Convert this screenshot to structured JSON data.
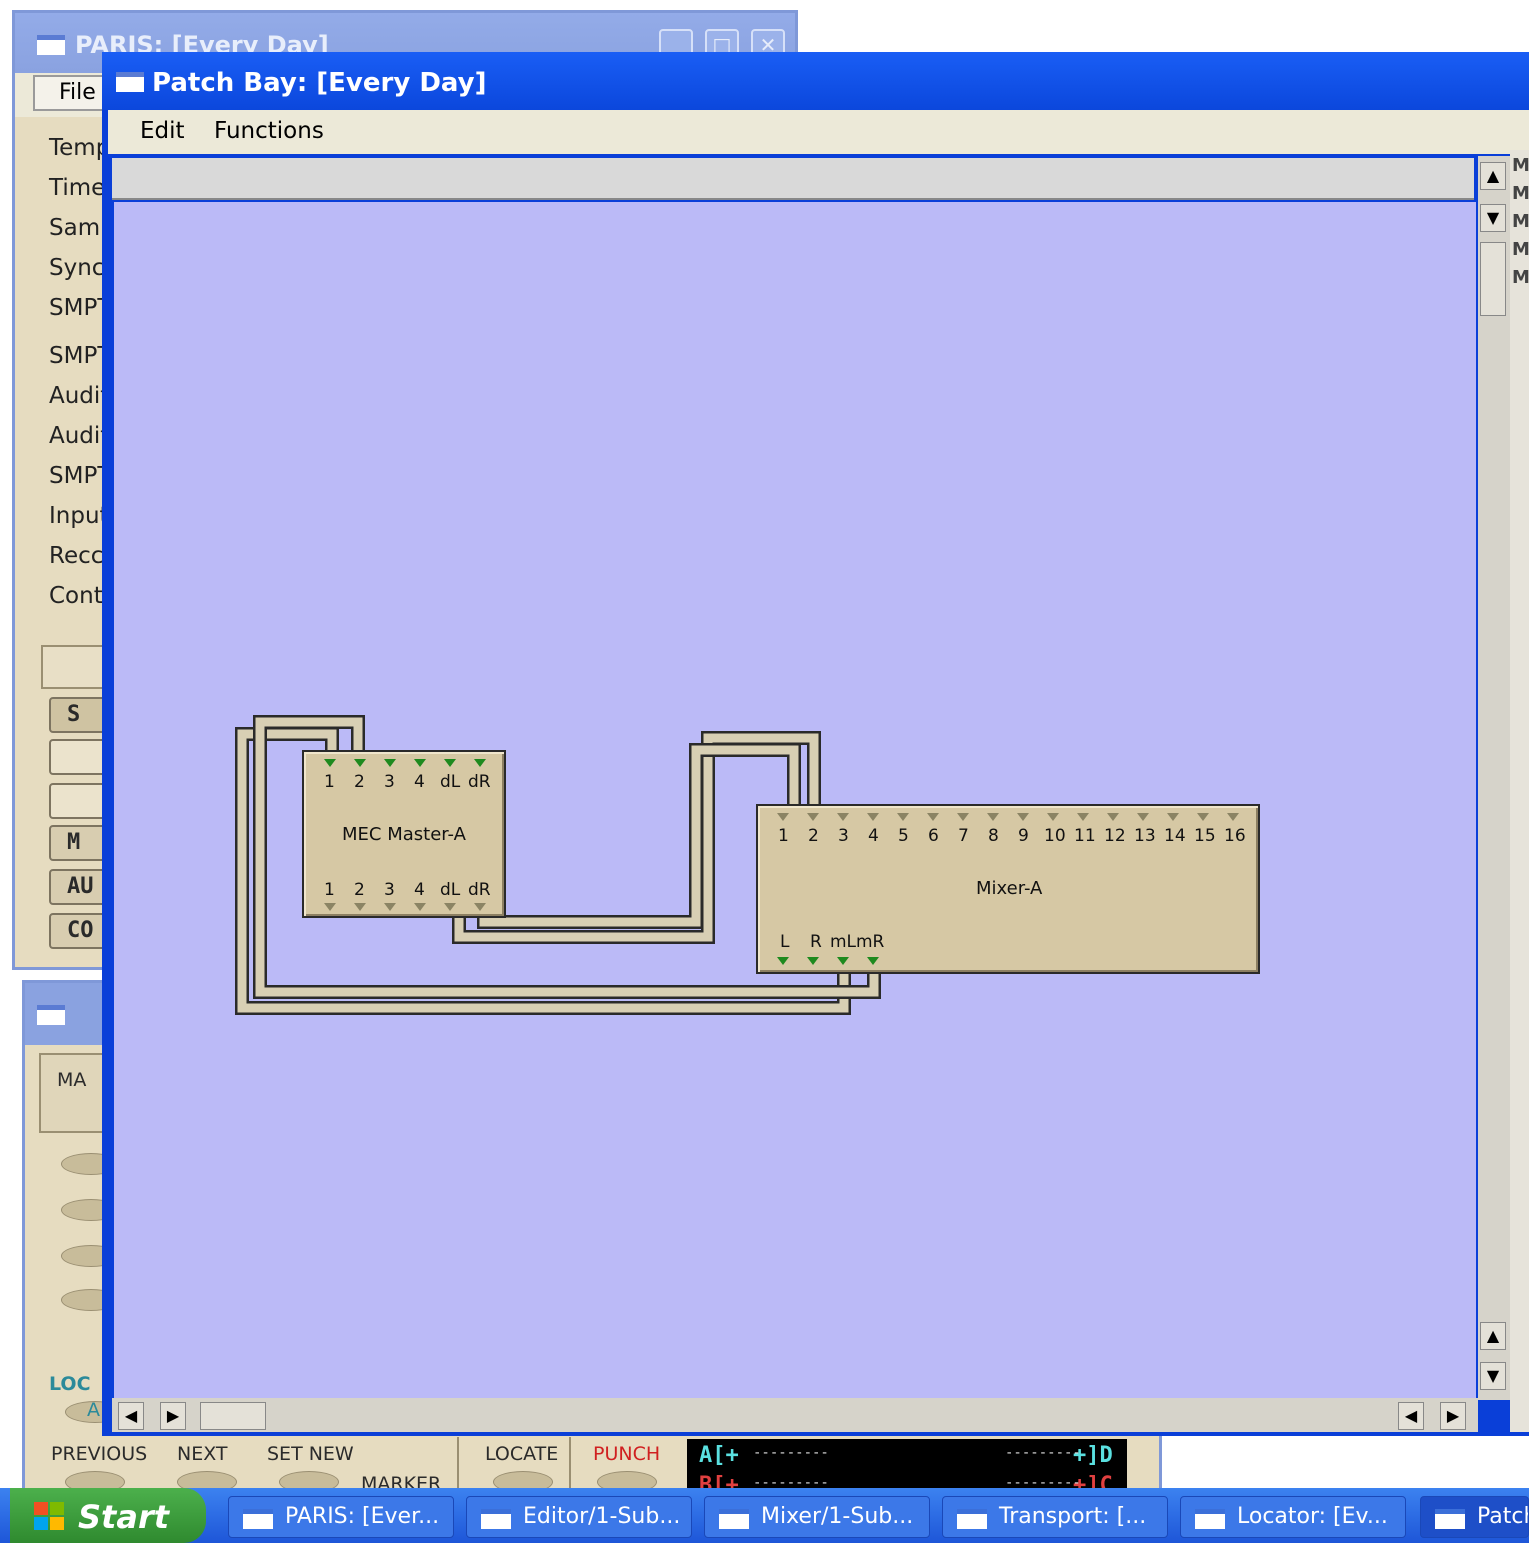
{
  "paris": {
    "title": "PARIS: [Every Day]",
    "menu_file": "File",
    "labels": [
      "Temp",
      "Time",
      "Sam",
      "Sync",
      "SMPT",
      "SMPT",
      "Audit",
      "Audit",
      "SMPT",
      "Input",
      "Recc",
      "Cont"
    ],
    "buttons": [
      "S",
      "",
      "",
      "M",
      "AU",
      "CO"
    ]
  },
  "patch": {
    "title": "Patch Bay: [Every Day]",
    "menu": [
      "Edit",
      "Functions"
    ],
    "right_strip": [
      "M",
      "M",
      "M",
      "M",
      "M"
    ]
  },
  "modules": {
    "mec": {
      "name": "MEC Master-A",
      "top_ports": [
        "1",
        "2",
        "3",
        "4",
        "dL",
        "dR"
      ],
      "bottom_ports": [
        "1",
        "2",
        "3",
        "4",
        "dL",
        "dR"
      ]
    },
    "mixer": {
      "name": "Mixer-A",
      "top_ports": [
        "1",
        "2",
        "3",
        "4",
        "5",
        "6",
        "7",
        "8",
        "9",
        "10",
        "11",
        "12",
        "13",
        "14",
        "15",
        "16"
      ],
      "bottom_ports": [
        "L",
        "R",
        "mL",
        "mR"
      ]
    }
  },
  "transport": {
    "ma_label": "MA",
    "loc_label": "LOC",
    "a_label": "A",
    "previous": "PREVIOUS",
    "next": "NEXT",
    "set_new": "SET NEW",
    "marker": "MARKER",
    "locate": "LOCATE",
    "punch": "PUNCH",
    "display_a_left": "A[+",
    "display_a_right": "+]D",
    "display_b_left": "B[+",
    "display_b_right": "+]C",
    "display_dashes": "---------"
  },
  "taskbar": {
    "start": "Start",
    "tasks": [
      "PARIS: [Ever...",
      "Editor/1-Sub...",
      "Mixer/1-Sub...",
      "Transport: [...",
      "Locator: [Ev...",
      "Patch"
    ]
  },
  "colors": {
    "canvas": "#bbbaf7",
    "module": "#d6c8a4",
    "titlebar": "#0b47dc",
    "cable": "#d8cfb4",
    "port_out": "#1e8a1e",
    "port_in": "#8b8464"
  }
}
